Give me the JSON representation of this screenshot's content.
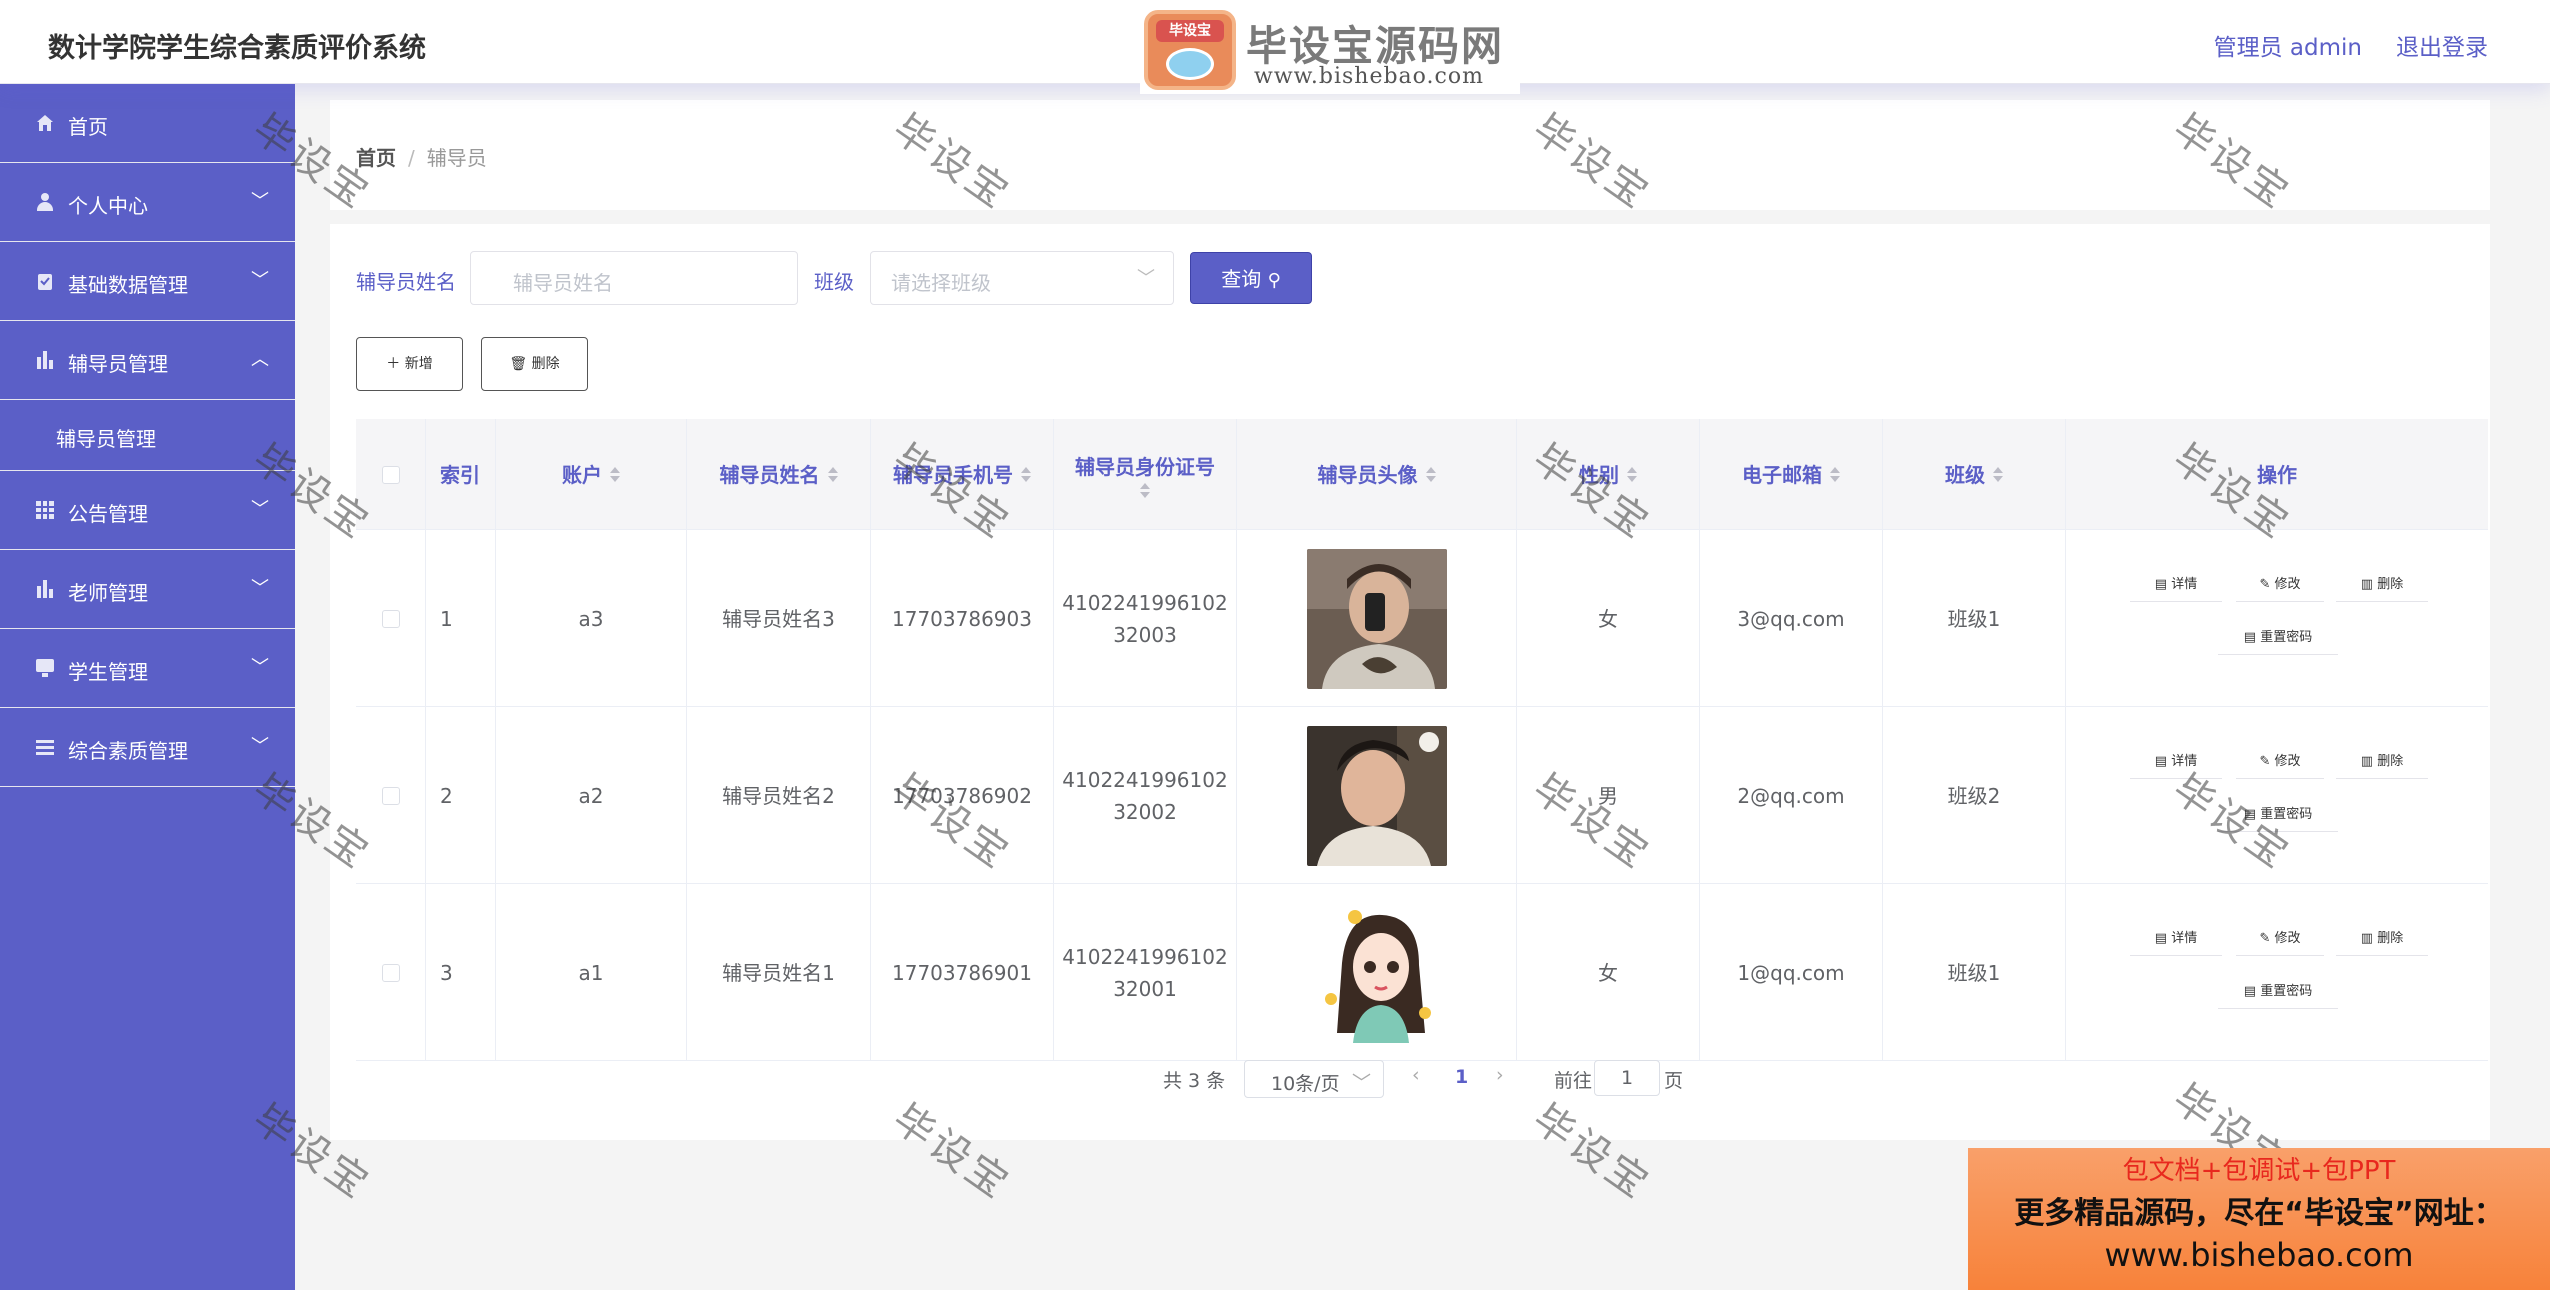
{
  "header": {
    "title": "数计学院学生综合素质评价系统",
    "user": "管理员 admin",
    "logout": "退出登录"
  },
  "watermark_logo": {
    "badge": "毕设宝",
    "name": "毕设宝源码网",
    "url": "www.bishebao.com"
  },
  "sidebar": {
    "items": [
      {
        "label": "首页",
        "icon": "home-icon"
      },
      {
        "label": "个人中心",
        "icon": "user-icon"
      },
      {
        "label": "基础数据管理",
        "icon": "clipboard-icon"
      },
      {
        "label": "辅导员管理",
        "icon": "bar-chart-icon",
        "expanded": true,
        "children": [
          {
            "label": "辅导员管理"
          }
        ]
      },
      {
        "label": "公告管理",
        "icon": "grid-icon"
      },
      {
        "label": "老师管理",
        "icon": "bar-chart-icon"
      },
      {
        "label": "学生管理",
        "icon": "monitor-icon"
      },
      {
        "label": "综合素质管理",
        "icon": "list-icon"
      }
    ]
  },
  "breadcrumb": {
    "home": "首页",
    "separator": "/",
    "current": "辅导员"
  },
  "search": {
    "name_label": "辅导员姓名",
    "name_placeholder": "辅导员姓名",
    "class_label": "班级",
    "class_placeholder": "请选择班级",
    "query_button": "查询"
  },
  "actions": {
    "add": "新增",
    "delete": "删除"
  },
  "table": {
    "columns": [
      "索引",
      "账户",
      "辅导员姓名",
      "辅导员手机号",
      "辅导员身份证号",
      "辅导员头像",
      "性别",
      "电子邮箱",
      "班级",
      "操作"
    ],
    "rows": [
      {
        "index": "1",
        "account": "a3",
        "name": "辅导员姓名3",
        "phone": "17703786903",
        "id_card_1": "4102241996102",
        "id_card_2": "32003",
        "gender": "女",
        "email": "3@qq.com",
        "class": "班级1"
      },
      {
        "index": "2",
        "account": "a2",
        "name": "辅导员姓名2",
        "phone": "17703786902",
        "id_card_1": "4102241996102",
        "id_card_2": "32002",
        "gender": "男",
        "email": "2@qq.com",
        "class": "班级2"
      },
      {
        "index": "3",
        "account": "a1",
        "name": "辅导员姓名1",
        "phone": "17703786901",
        "id_card_1": "4102241996102",
        "id_card_2": "32001",
        "gender": "女",
        "email": "1@qq.com",
        "class": "班级1"
      }
    ],
    "row_actions": {
      "detail": "详情",
      "edit": "修改",
      "delete": "删除",
      "reset_password": "重置密码"
    }
  },
  "pagination": {
    "total": "共 3 条",
    "page_size": "10条/页",
    "current_page": "1",
    "goto": "前往",
    "goto_value": "1",
    "page_unit": "页"
  },
  "watermark_text": "毕设宝",
  "ad": {
    "line1": "包文档+包调试+包PPT",
    "line2": "更多精品源码，尽在“毕设宝”网址：",
    "line3": "www.bishebao.com"
  },
  "colors": {
    "primary": "#5b5fc7",
    "ad_bg": "#f7823a",
    "ad_red": "#e8281e"
  }
}
